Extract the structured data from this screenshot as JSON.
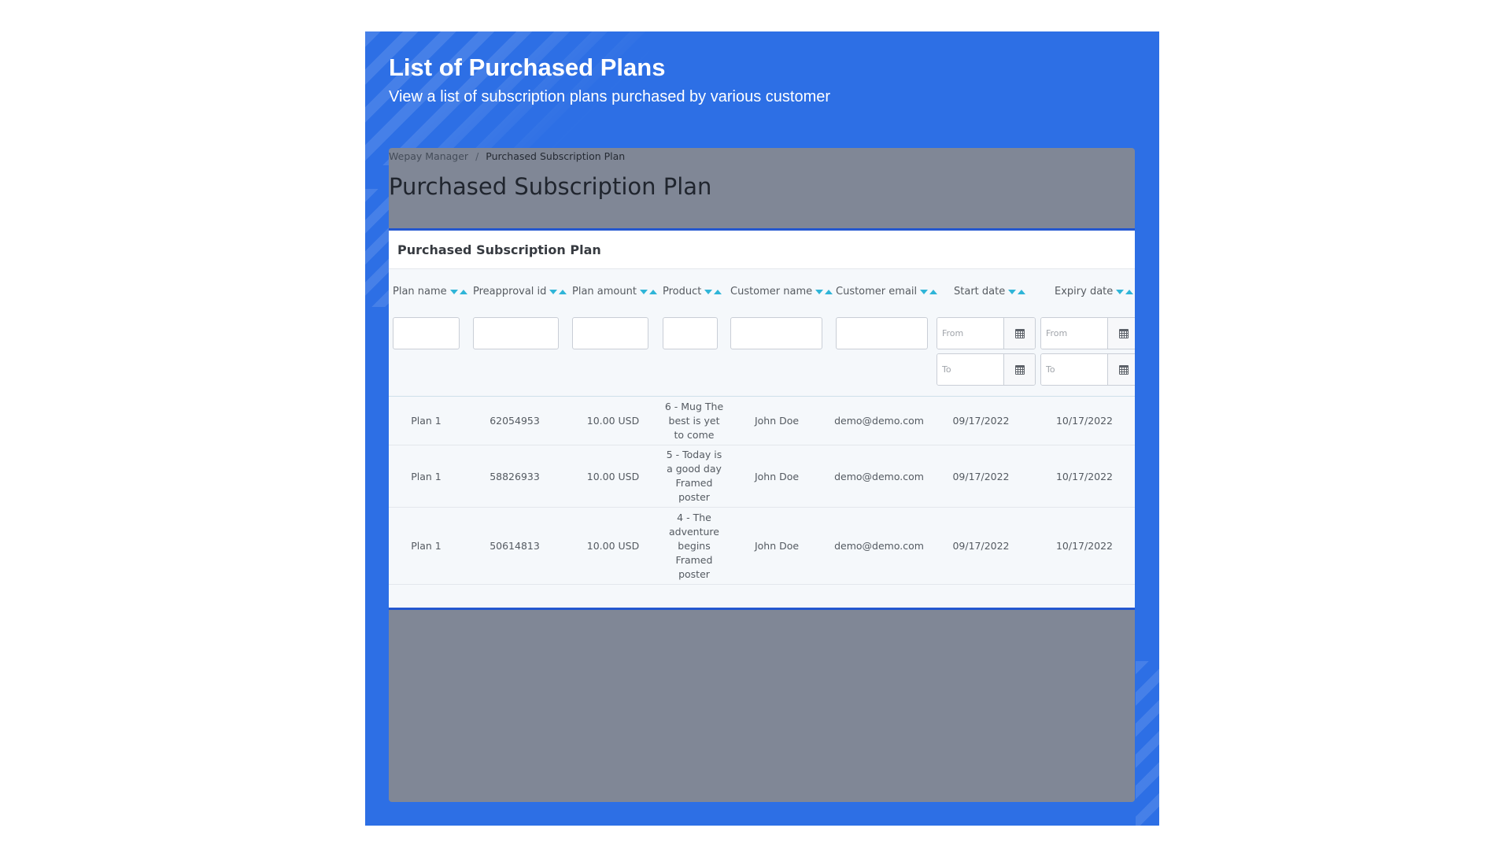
{
  "promo": {
    "title": "List of Purchased Plans",
    "subtitle": "View a list of subscription plans purchased by various customer",
    "background_color": "#2d6fe5"
  },
  "breadcrumb": {
    "parent": "Wepay Manager",
    "separator": "/",
    "current": "Purchased Subscription Plan"
  },
  "page": {
    "title": "Purchased Subscription Plan"
  },
  "card": {
    "title": "Purchased Subscription Plan"
  },
  "table": {
    "columns": [
      {
        "label": "Plan name"
      },
      {
        "label": "Preapproval id"
      },
      {
        "label": "Plan amount"
      },
      {
        "label": "Product"
      },
      {
        "label": "Customer name"
      },
      {
        "label": "Customer email"
      },
      {
        "label": "Start date"
      },
      {
        "label": "Expiry date"
      }
    ],
    "filters": {
      "from_placeholder": "From",
      "to_placeholder": "To",
      "calendar_icon": "calendar-icon"
    },
    "rows": [
      {
        "plan": "Plan 1",
        "preapproval": "62054953",
        "amount": "10.00 USD",
        "product": "6 - Mug The best is yet to come",
        "customer": "John Doe",
        "email": "demo@demo.com",
        "start": "09/17/2022",
        "expiry": "10/17/2022"
      },
      {
        "plan": "Plan 1",
        "preapproval": "58826933",
        "amount": "10.00 USD",
        "product": "5 - Today is a good day Framed poster",
        "customer": "John Doe",
        "email": "demo@demo.com",
        "start": "09/17/2022",
        "expiry": "10/17/2022"
      },
      {
        "plan": "Plan 1",
        "preapproval": "50614813",
        "amount": "10.00 USD",
        "product": "4 - The adventure begins Framed poster",
        "customer": "John Doe",
        "email": "demo@demo.com",
        "start": "09/17/2022",
        "expiry": "10/17/2022"
      }
    ]
  },
  "colors": {
    "accent": "#2457cf",
    "sort_arrow": "#2fb5d8",
    "frame_overlay": "#808796"
  }
}
